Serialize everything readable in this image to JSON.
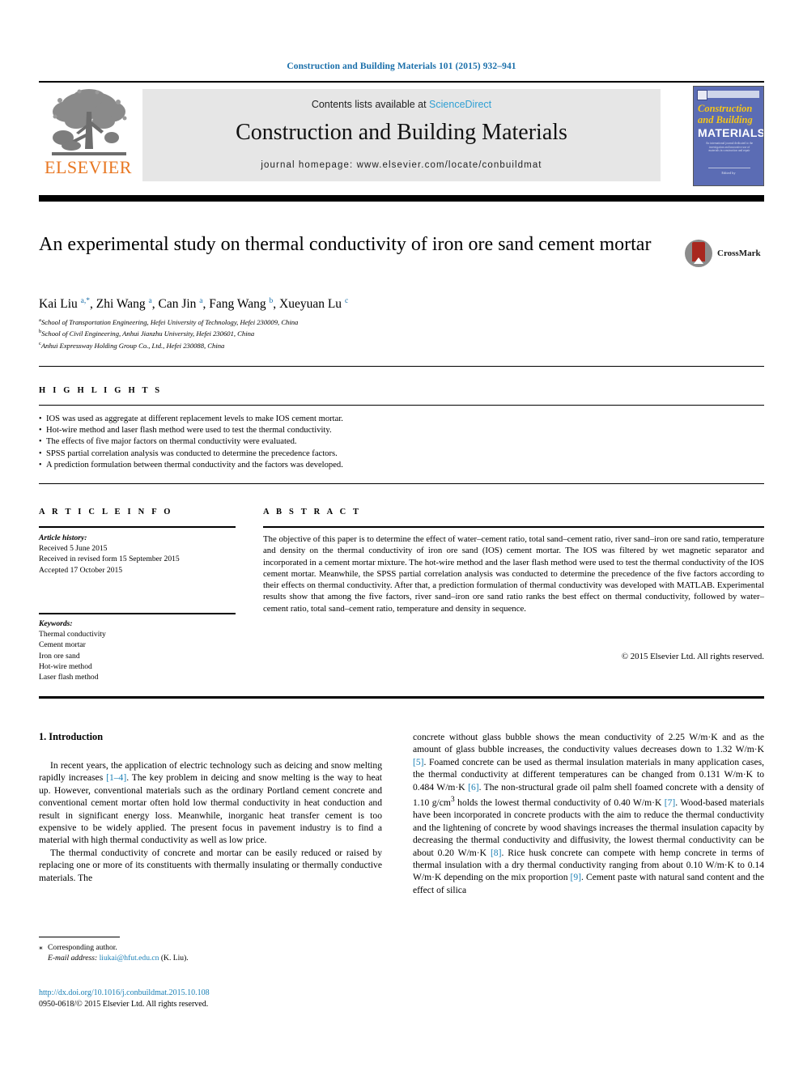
{
  "running_head": "Construction and Building Materials 101 (2015) 932–941",
  "masthead": {
    "publisher_name": "ELSEVIER",
    "contents_prefix": "Contents lists available at ",
    "contents_link": "ScienceDirect",
    "journal_title": "Construction and Building Materials",
    "homepage": "journal homepage: www.elsevier.com/locate/conbuildmat",
    "cover": {
      "line1": "Construction",
      "line2": "and Building",
      "line3": "MATERIALS",
      "blurb": "An international journal dedicated to the investigation and innovative use of materials in construction and repair",
      "footer": "Edited by"
    }
  },
  "article": {
    "title": "An experimental study on thermal conductivity of iron ore sand cement mortar",
    "crossmark_label": "CrossMark",
    "authors_html": "Kai Liu <sup>a,*</sup>, Zhi Wang <sup>a</sup>, Can Jin <sup>a</sup>, Fang Wang <sup>b</sup>, Xueyuan Lu <sup>c</sup>",
    "affiliations": [
      {
        "marker": "a",
        "text": "School of Transportation Engineering, Hefei University of Technology, Hefei 230009, China"
      },
      {
        "marker": "b",
        "text": "School of Civil Engineering, Anhui Jianzhu University, Hefei 230601, China"
      },
      {
        "marker": "c",
        "text": "Anhui Expressway Holding Group Co., Ltd., Hefei 230088, China"
      }
    ]
  },
  "highlights": {
    "heading": "H I G H L I G H T S",
    "items": [
      "IOS was used as aggregate at different replacement levels to make IOS cement mortar.",
      "Hot-wire method and laser flash method were used to test the thermal conductivity.",
      "The effects of five major factors on thermal conductivity were evaluated.",
      "SPSS partial correlation analysis was conducted to determine the precedence factors.",
      "A prediction formulation between thermal conductivity and the factors was developed."
    ]
  },
  "article_info": {
    "heading": "A R T I C L E  I N F O",
    "history_label": "Article history:",
    "history": [
      "Received 5 June 2015",
      "Received in revised form 15 September 2015",
      "Accepted 17 October 2015"
    ],
    "keywords_label": "Keywords:",
    "keywords": [
      "Thermal conductivity",
      "Cement mortar",
      "Iron ore sand",
      "Hot-wire method",
      "Laser flash method"
    ]
  },
  "abstract": {
    "heading": "A B S T R A C T",
    "text": "The objective of this paper is to determine the effect of water–cement ratio, total sand–cement ratio, river sand–iron ore sand ratio, temperature and density on the thermal conductivity of iron ore sand (IOS) cement mortar. The IOS was filtered by wet magnetic separator and incorporated in a cement mortar mixture. The hot-wire method and the laser flash method were used to test the thermal conductivity of the IOS cement mortar. Meanwhile, the SPSS partial correlation analysis was conducted to determine the precedence of the five factors according to their effects on thermal conductivity. After that, a prediction formulation of thermal conductivity was developed with MATLAB. Experimental results show that among the five factors, river sand–iron ore sand ratio ranks the best effect on thermal conductivity, followed by water–cement ratio, total sand–cement ratio, temperature and density in sequence.",
    "copyright": "© 2015 Elsevier Ltd. All rights reserved."
  },
  "body": {
    "section_title": "1. Introduction",
    "left_paragraph_1_html": "In recent years, the application of electric technology such as deicing and snow melting rapidly increases <span class=\"ref\">[1–4]</span>. The key problem in deicing and snow melting is the way to heat up. However, conventional materials such as the ordinary Portland cement concrete and conventional cement mortar often hold low thermal conductivity in heat conduction and result in significant energy loss. Meanwhile, inorganic heat transfer cement is too expensive to be widely applied. The present focus in pavement industry is to find a material with high thermal conductivity as well as low price.",
    "left_paragraph_2_html": "The thermal conductivity of concrete and mortar can be easily reduced or raised by replacing one or more of its constituents with thermally insulating or thermally conductive materials. The",
    "right_paragraph_html": "concrete without glass bubble shows the mean conductivity of 2.25 W/m·K and as the amount of glass bubble increases, the conductivity values decreases down to 1.32 W/m·K <span class=\"ref\">[5]</span>. Foamed concrete can be used as thermal insulation materials in many application cases, the thermal conductivity at different temperatures can be changed from 0.131 W/m·K to 0.484 W/m·K <span class=\"ref\">[6]</span>. The non-structural grade oil palm shell foamed concrete with a density of 1.10 g/cm<sup>3</sup> holds the lowest thermal conductivity of 0.40 W/m·K <span class=\"ref\">[7]</span>. Wood-based materials have been incorporated in concrete products with the aim to reduce the thermal conductivity and the lightening of concrete by wood shavings increases the thermal insulation capacity by decreasing the thermal conductivity and diffusivity, the lowest thermal conductivity can be about 0.20 W/m·K <span class=\"ref\">[8]</span>. Rice husk concrete can compete with hemp concrete in terms of thermal insulation with a dry thermal conductivity ranging from about 0.10 W/m·K to 0.14 W/m·K depending on the mix proportion <span class=\"ref\">[9]</span>. Cement paste with natural sand content and the effect of silica"
  },
  "footer": {
    "corresponding_star": "⁎",
    "corresponding_text": "Corresponding author.",
    "email_label": "E-mail address:",
    "email": "liukai@hfut.edu.cn",
    "email_owner": "(K. Liu).",
    "doi": "http://dx.doi.org/10.1016/j.conbuildmat.2015.10.108",
    "issn_line": "0950-0618/© 2015 Elsevier Ltd. All rights reserved."
  },
  "colors": {
    "link_blue": "#1a7fb5",
    "sciencedirect_blue": "#2e9fd4",
    "elsevier_orange": "#e87722",
    "cover_blue": "#5b6cb4",
    "cover_yellow": "#f5c518"
  }
}
